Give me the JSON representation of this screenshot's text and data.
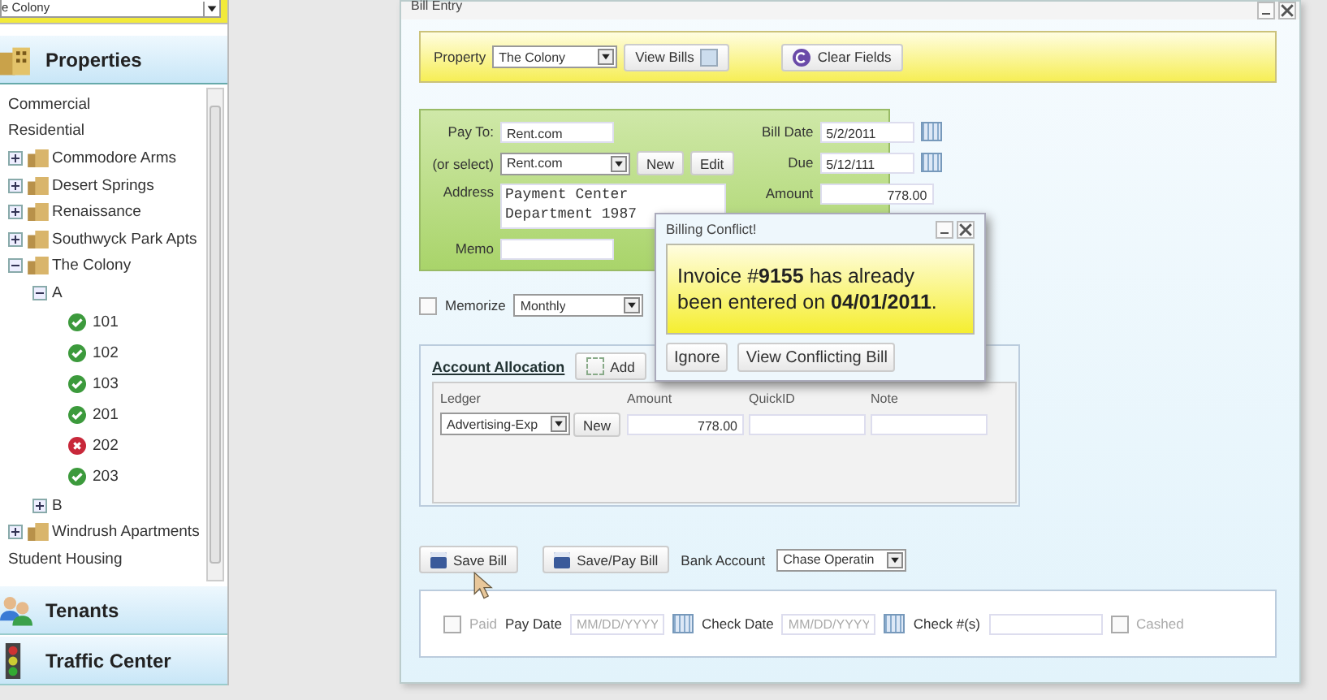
{
  "sidebar": {
    "property_select": "e Colony",
    "sections": [
      {
        "label": "Properties",
        "kind": "properties",
        "expanded": true
      },
      {
        "label": "Tenants",
        "kind": "tenants",
        "expanded": false
      },
      {
        "label": "Traffic Center",
        "kind": "traffic",
        "expanded": false
      }
    ],
    "tree": [
      {
        "label": "Commercial",
        "kind": "group"
      },
      {
        "label": "Residential",
        "kind": "group",
        "children": [
          {
            "label": "Commodore Arms",
            "kind": "property",
            "expanded": false
          },
          {
            "label": "Desert Springs",
            "kind": "property",
            "expanded": false
          },
          {
            "label": "Renaissance",
            "kind": "property",
            "expanded": false
          },
          {
            "label": "Southwyck Park Apts",
            "kind": "property",
            "expanded": false
          },
          {
            "label": "The Colony",
            "kind": "property",
            "expanded": true,
            "children": [
              {
                "label": "A",
                "kind": "section",
                "expanded": true,
                "children": [
                  {
                    "label": "101",
                    "kind": "unit",
                    "error": false
                  },
                  {
                    "label": "102",
                    "kind": "unit",
                    "error": false
                  },
                  {
                    "label": "103",
                    "kind": "unit",
                    "error": false
                  },
                  {
                    "label": "201",
                    "kind": "unit",
                    "error": false
                  },
                  {
                    "label": "202",
                    "kind": "unit",
                    "error": true
                  },
                  {
                    "label": "203",
                    "kind": "unit",
                    "error": false
                  }
                ]
              },
              {
                "label": "B",
                "kind": "section",
                "expanded": false
              }
            ]
          },
          {
            "label": "Windrush Apartments",
            "kind": "property",
            "expanded": false
          }
        ]
      },
      {
        "label": "Student Housing",
        "kind": "group"
      }
    ]
  },
  "window": {
    "title": "Bill Entry",
    "toolbar": {
      "property_label": "Property",
      "property": "The Colony",
      "view_bills": "View Bills",
      "clear_fields": "Clear Fields"
    },
    "form": {
      "pay_to_label": "Pay To:",
      "pay_to": "Rent.com",
      "select_label": "(or select)",
      "select": "Rent.com",
      "new": "New",
      "edit": "Edit",
      "address_label": "Address",
      "address": [
        "Payment Center",
        "Department 1987"
      ],
      "memo_label": "Memo",
      "bill_date_label": "Bill Date",
      "bill_date": "5/2/2011",
      "due_label": "Due",
      "due": "5/12/111",
      "amount_label": "Amount",
      "amount": "778.00"
    },
    "memorize": {
      "label": "Memorize",
      "checked": false,
      "frequency": "Monthly"
    },
    "allocation": {
      "title": "Account Allocation",
      "add": "Add",
      "columns": [
        "Ledger",
        "Amount",
        "QuickID",
        "Note"
      ],
      "rows": [
        {
          "ledger": "Advertising-Exp",
          "new": "New",
          "amount": "778.00"
        }
      ]
    },
    "actions": {
      "save": "Save Bill",
      "save_pay": "Save/Pay Bill",
      "bank_label": "Bank Account",
      "bank": "Chase Operatin"
    },
    "payment": {
      "paid_label": "Paid",
      "paid": false,
      "pay_date_label": "Pay Date",
      "pay_date_placeholder": "MM/DD/YYYY",
      "check_date_label": "Check Date",
      "check_date_placeholder": "MM/DD/YYYY",
      "check_no_label": "Check #(s)",
      "cashed_label": "Cashed",
      "cashed": false
    }
  },
  "dialog": {
    "title": "Billing Conflict!",
    "message": "Invoice #**9155** has already been entered on **04/01/2011**.",
    "buttons": [
      "Ignore",
      "View Conflicting Bill"
    ]
  }
}
